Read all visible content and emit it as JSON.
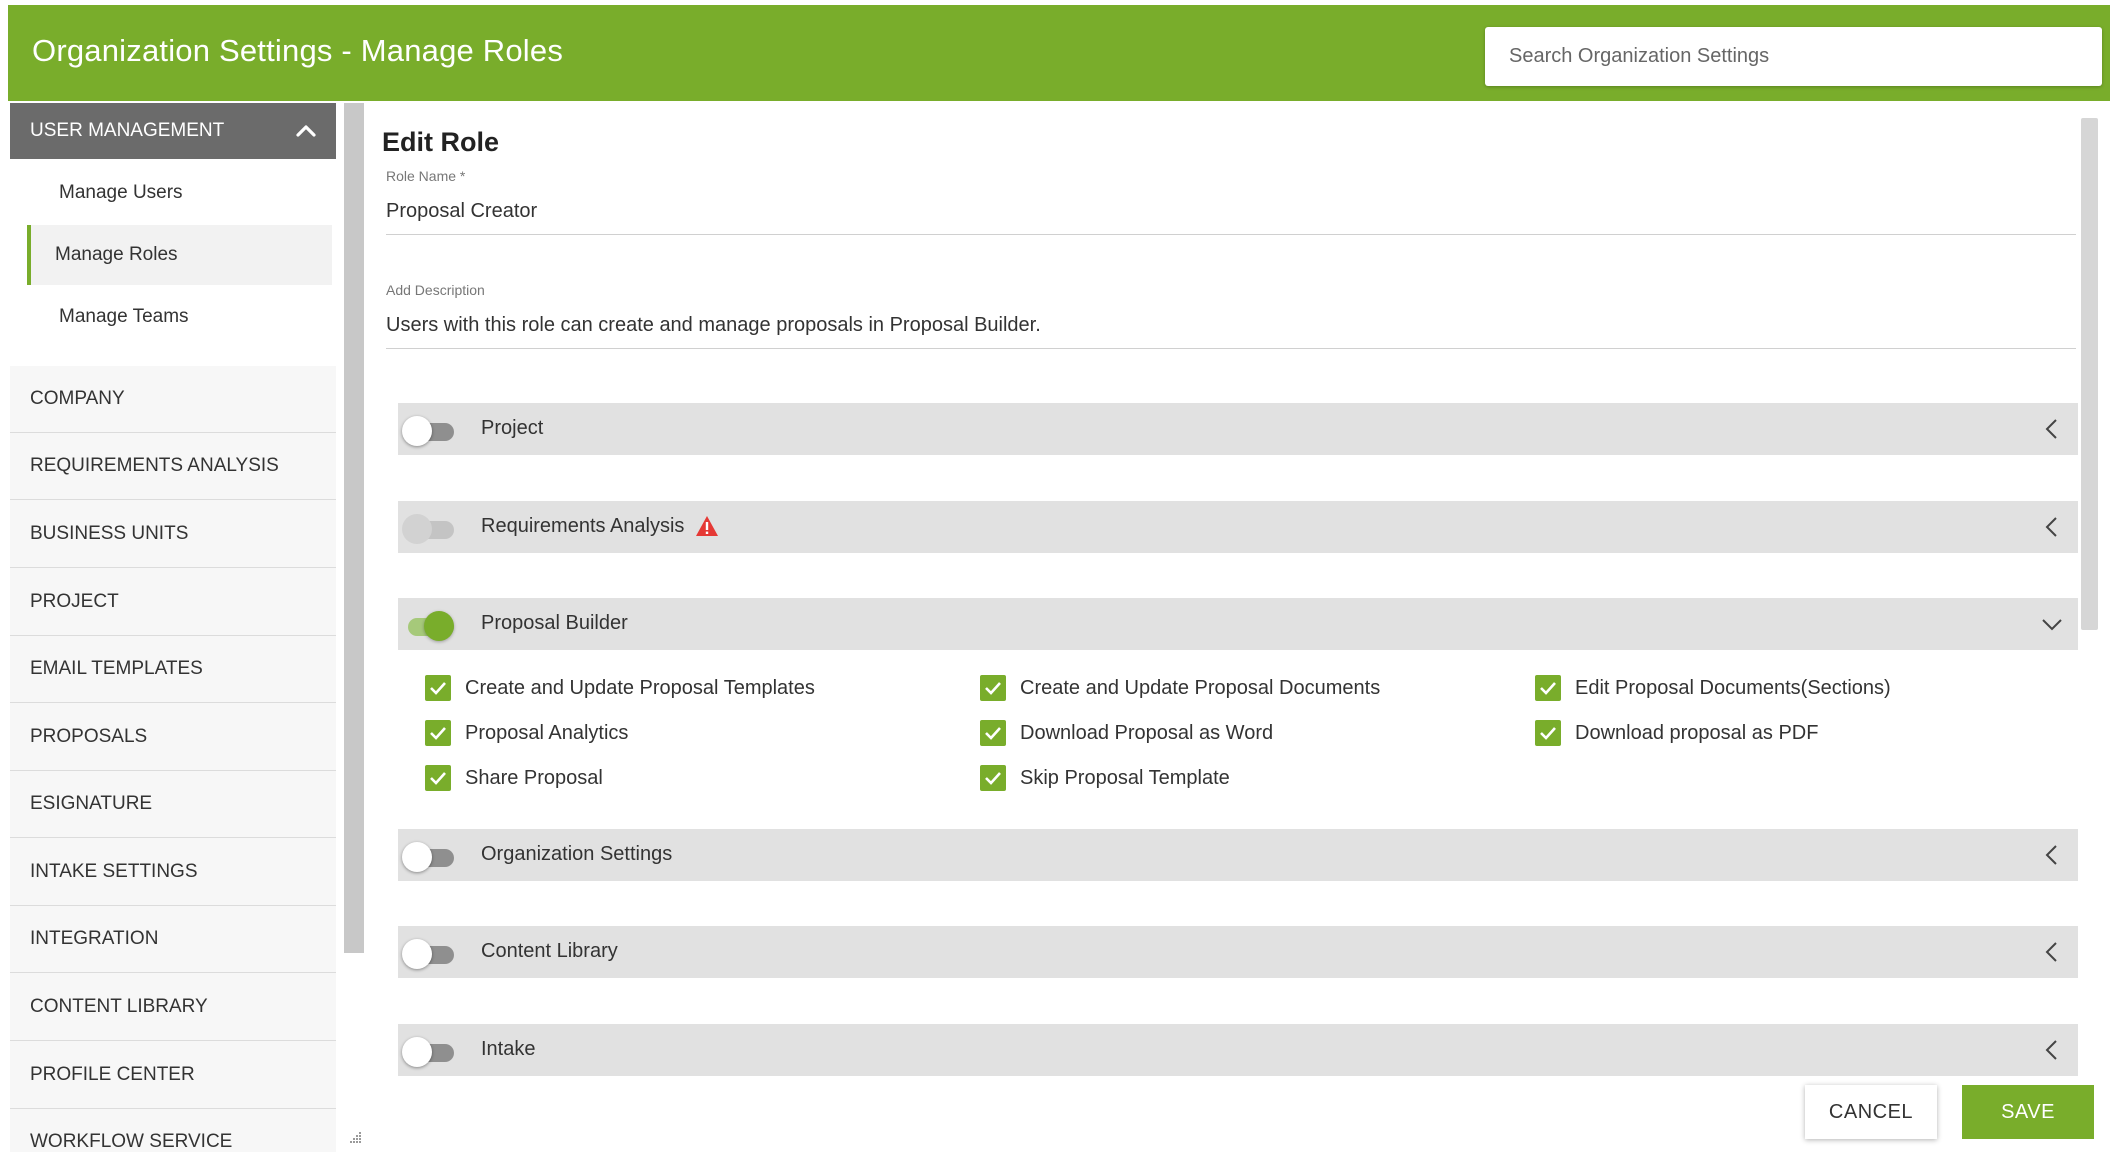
{
  "header": {
    "title": "Organization Settings - Manage Roles",
    "search_placeholder": "Search Organization Settings"
  },
  "sidebar": {
    "group": {
      "label": "USER MANAGEMENT",
      "icon": "chevron-up-icon"
    },
    "subitems": [
      {
        "label": "Manage Users"
      },
      {
        "label": "Manage Roles",
        "active": true
      },
      {
        "label": "Manage Teams"
      }
    ],
    "items": [
      {
        "label": "COMPANY"
      },
      {
        "label": "REQUIREMENTS ANALYSIS"
      },
      {
        "label": "BUSINESS UNITS"
      },
      {
        "label": "PROJECT"
      },
      {
        "label": "EMAIL TEMPLATES"
      },
      {
        "label": "PROPOSALS"
      },
      {
        "label": "ESIGNATURE"
      },
      {
        "label": "INTAKE SETTINGS"
      },
      {
        "label": "INTEGRATION"
      },
      {
        "label": "CONTENT LIBRARY"
      },
      {
        "label": "PROFILE CENTER"
      },
      {
        "label": "WORKFLOW SERVICE"
      }
    ]
  },
  "main": {
    "title": "Edit Role",
    "role_name_label": "Role Name",
    "role_name_required": "*",
    "role_name_value": "Proposal Creator",
    "description_label": "Add Description",
    "description_value": "Users with this role can create and manage proposals in Proposal Builder.",
    "sections": [
      {
        "label": "Project",
        "toggle": "off",
        "expanded": false
      },
      {
        "label": "Requirements Analysis",
        "toggle": "disabled",
        "expanded": false,
        "warning": true
      },
      {
        "label": "Proposal Builder",
        "toggle": "on",
        "expanded": true
      },
      {
        "label": "Organization Settings",
        "toggle": "off",
        "expanded": false
      },
      {
        "label": "Content Library",
        "toggle": "off",
        "expanded": false
      },
      {
        "label": "Intake",
        "toggle": "off",
        "expanded": false
      }
    ],
    "proposal_builder_permissions": [
      {
        "label": "Create and Update Proposal Templates",
        "checked": true
      },
      {
        "label": "Create and Update Proposal Documents",
        "checked": true
      },
      {
        "label": "Edit Proposal Documents(Sections)",
        "checked": true
      },
      {
        "label": "Proposal Analytics",
        "checked": true
      },
      {
        "label": "Download Proposal as Word",
        "checked": true
      },
      {
        "label": "Download proposal as PDF",
        "checked": true
      },
      {
        "label": "Share Proposal",
        "checked": true
      },
      {
        "label": "Skip Proposal Template",
        "checked": true
      }
    ]
  },
  "actions": {
    "cancel_label": "CANCEL",
    "save_label": "SAVE"
  },
  "colors": {
    "brand_green": "#79ad2b",
    "sidebar_header": "#6b6b6b",
    "section_bar": "#e1e1e1",
    "warning_red": "#e53935"
  }
}
